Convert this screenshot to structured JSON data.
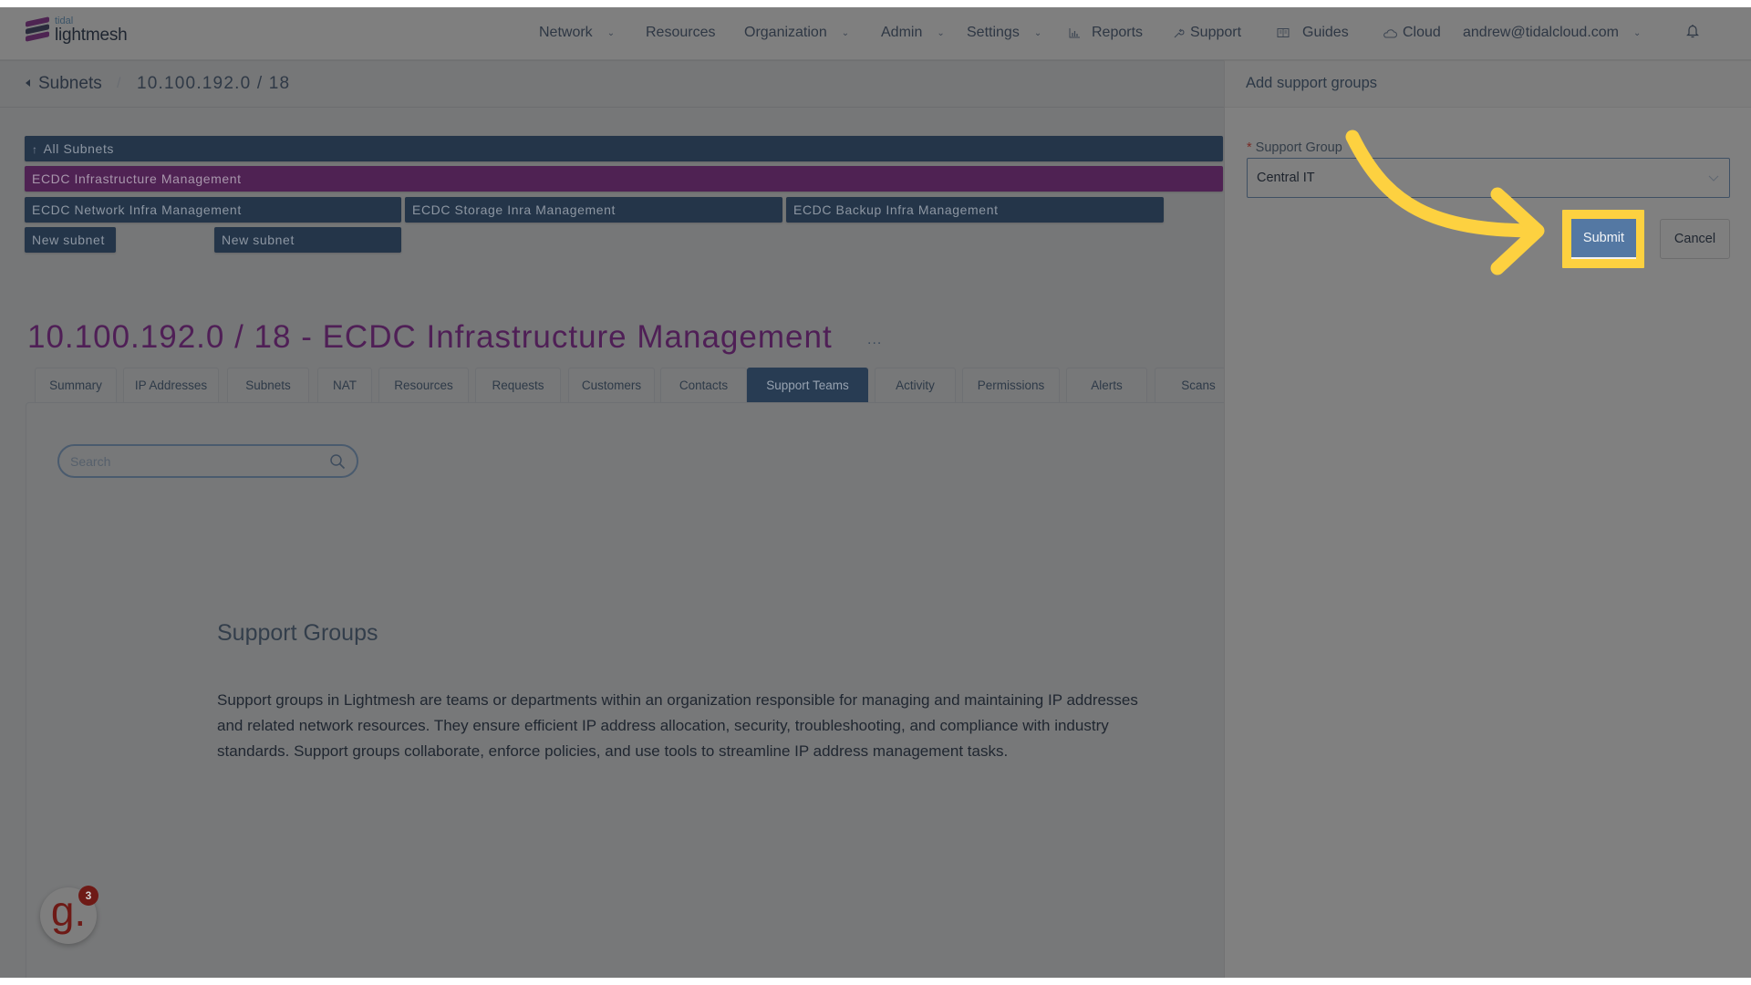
{
  "header": {
    "logo_small": "tidal",
    "logo_big": "lightmesh",
    "nav": [
      {
        "label": "Network",
        "icon": "",
        "dropdown": true
      },
      {
        "label": "Resources",
        "icon": "",
        "dropdown": false
      },
      {
        "label": "Organization",
        "icon": "",
        "dropdown": true
      },
      {
        "label": "Admin",
        "icon": "",
        "dropdown": true
      },
      {
        "label": "Settings",
        "icon": "",
        "dropdown": true
      },
      {
        "label": "Reports",
        "icon": "bar-chart-icon",
        "dropdown": false
      },
      {
        "label": "Support",
        "icon": "wrench-icon",
        "dropdown": false
      },
      {
        "label": "Guides",
        "icon": "book-icon",
        "dropdown": false
      },
      {
        "label": "Cloud",
        "icon": "cloud-icon",
        "dropdown": false
      }
    ],
    "user": "andrew@tidalcloud.com",
    "caret": "⌄",
    "icons": {
      "bar_chart": "📊",
      "wrench": "🔧",
      "book": "📖",
      "cloud": "☁"
    }
  },
  "breadcrumb": {
    "back": "Subnets",
    "separator": "/",
    "current": "10.100.192.0 / 18"
  },
  "subnet_tree": {
    "all": "All Subnets",
    "all_icon": "↑",
    "selected": "ECDC Infrastructure Management",
    "children": [
      "ECDC Network Infra Management",
      "ECDC Storage Inra Management",
      "ECDC Backup Infra Management"
    ],
    "new_subnets": [
      "New subnet",
      "New subnet"
    ]
  },
  "page": {
    "title": "10.100.192.0 / 18 - ECDC Infrastructure Management",
    "more": "...",
    "tabs": [
      {
        "label": "Summary",
        "active": false
      },
      {
        "label": "IP Addresses",
        "active": false
      },
      {
        "label": "Subnets",
        "active": false
      },
      {
        "label": "NAT",
        "active": false
      },
      {
        "label": "Resources",
        "active": false
      },
      {
        "label": "Requests",
        "active": false
      },
      {
        "label": "Customers",
        "active": false
      },
      {
        "label": "Contacts",
        "active": false
      },
      {
        "label": "Support Teams",
        "active": true
      },
      {
        "label": "Activity",
        "active": false
      },
      {
        "label": "Permissions",
        "active": false
      },
      {
        "label": "Alerts",
        "active": false
      },
      {
        "label": "Scans",
        "active": false
      }
    ],
    "search_placeholder": "Search",
    "empty_title": "Support Groups",
    "empty_text": "Support groups in Lightmesh are teams or departments within an organization responsible for managing and maintaining IP addresses and related network resources. They ensure efficient IP address allocation, security, troubleshooting, and compliance with industry standards. Support groups collaborate, enforce policies, and use tools to streamline IP address management tasks."
  },
  "drawer": {
    "title": "Add support groups",
    "field_label": "Support Group",
    "required_mark": "*",
    "selected_value": "Central IT",
    "submit_label": "Submit",
    "cancel_label": "Cancel"
  },
  "overlay": {
    "highlight_color": "#fdd140",
    "callout": "arrow-pointing-to-submit"
  },
  "grammarly": {
    "glyph": "g.",
    "badge_count": "3"
  },
  "colors": {
    "brand_purple": "#4f1f56",
    "navy": "#243549",
    "active_tab": "#283c53",
    "submit_blue": "#5478a3",
    "grammarly_red": "#6e1a16"
  }
}
